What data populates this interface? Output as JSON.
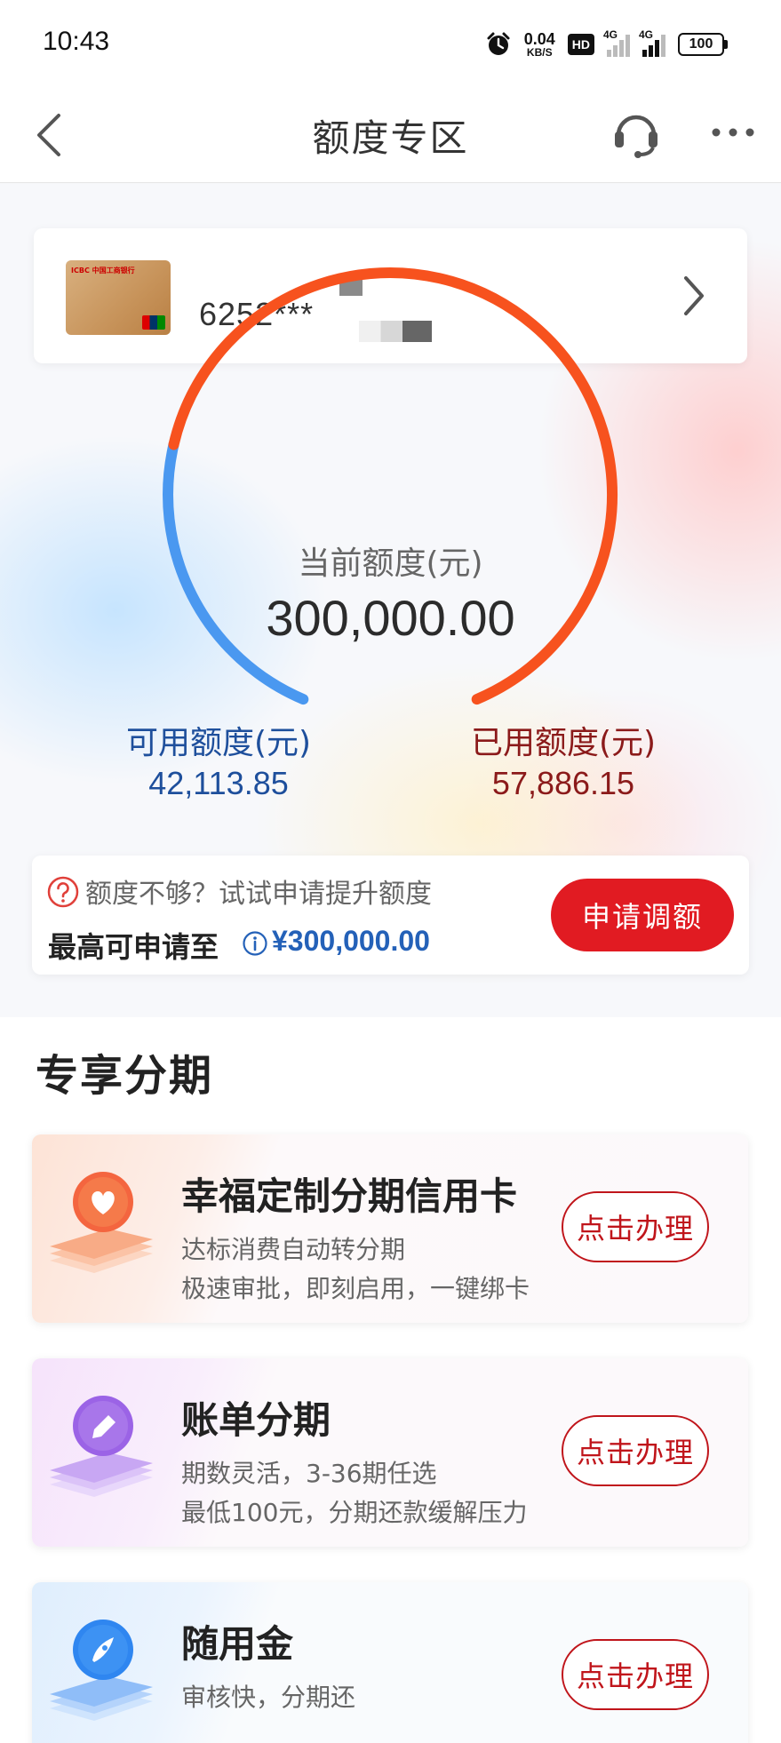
{
  "status_bar": {
    "time": "10:43",
    "net_speed_value": "0.04",
    "net_speed_unit": "KB/S",
    "hd_label": "HD",
    "sig1_label": "4G",
    "sig2_label": "4G",
    "battery": "100"
  },
  "nav": {
    "title": "额度专区",
    "back_icon": "chevron-left-icon",
    "service_icon": "headset-icon",
    "more_icon": "more-icon"
  },
  "card": {
    "number": "6252***",
    "bank_logo_text": "ICBC 中国工商银行"
  },
  "gauge": {
    "label": "当前额度(元)",
    "total": "300,000.00",
    "available_label": "可用额度(元)",
    "available_value": "42,113.85",
    "used_label": "已用额度(元)",
    "used_value": "57,886.15",
    "total_number": 300000,
    "available_number": 42113.85,
    "used_number": 57886.15,
    "colors": {
      "available": "#4a98f0",
      "used": "#f7521e"
    }
  },
  "apply": {
    "hint": "额度不够？试试申请提升额度",
    "max_label": "最高可申请至",
    "max_value": "¥300,000.00",
    "button": "申请调额"
  },
  "section": {
    "title": "专享分期",
    "offers": [
      {
        "title": "幸福定制分期信用卡",
        "desc1": "达标消费自动转分期",
        "desc2": "极速审批，即刻启用，一键绑卡",
        "button": "点击办理",
        "icon": "heart-icon",
        "color": "#f25a3c"
      },
      {
        "title": "账单分期",
        "desc1": "期数灵活，3-36期任选",
        "desc2": "最低100元，分期还款缓解压力",
        "button": "点击办理",
        "icon": "pencil-icon",
        "color": "#9b63e6"
      },
      {
        "title": "随用金",
        "desc1": "审核快，分期还",
        "desc2": "",
        "button": "点击办理",
        "icon": "rocket-icon",
        "color": "#2f86f0"
      }
    ]
  }
}
